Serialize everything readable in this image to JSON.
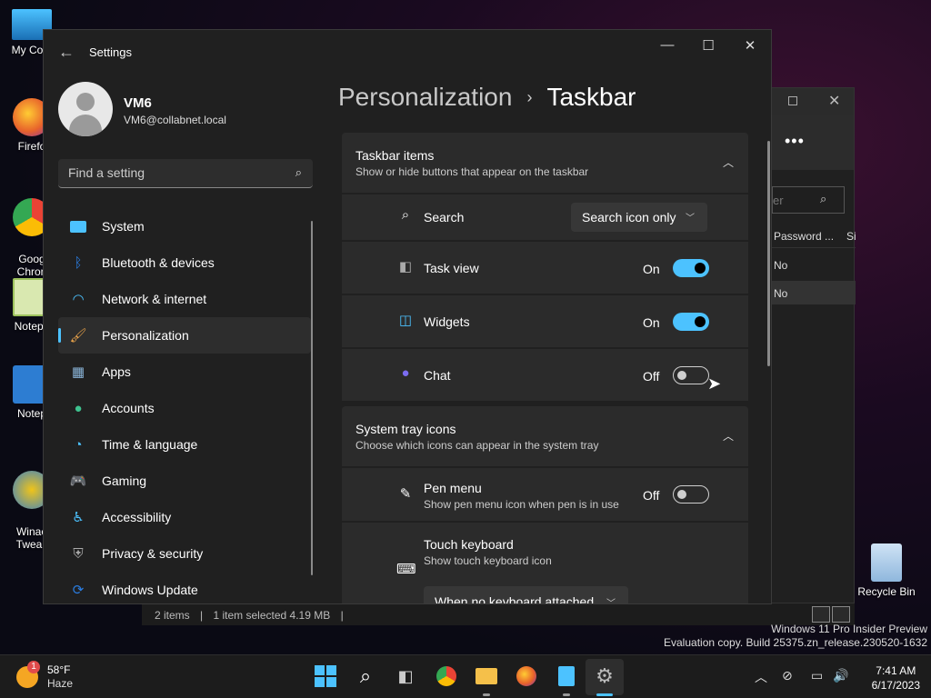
{
  "desktop": {
    "icons": [
      {
        "label": "My Com",
        "icon": "computer-icon",
        "color": "#2aa7e0"
      },
      {
        "label": "Firefo",
        "icon": "firefox-icon",
        "color": "#e8632b"
      },
      {
        "label": "Goog\nChron",
        "icon": "chrome-icon",
        "color": "#34a853"
      },
      {
        "label": "Notepa",
        "icon": "notepad-plus-icon",
        "color": "#9cc25c"
      },
      {
        "label": "Notep",
        "icon": "notepad-icon",
        "color": "#2d7dd2"
      },
      {
        "label": "Winae\nTweak",
        "icon": "winaero-tweaker-icon",
        "color": "#f0c419"
      },
      {
        "label": "Recycle Bin",
        "icon": "recycle-bin-icon",
        "color": "#9ec9f0"
      }
    ]
  },
  "explorer_bg": {
    "search_placeholder": "er",
    "col_password": "Password ...",
    "col_size": "Si",
    "rows": [
      "No",
      "No"
    ],
    "status": {
      "items": "2 items",
      "selected": "1 item selected  4.19 MB",
      "sep": "|"
    }
  },
  "watermark": {
    "line1": "Windows 11 Pro Insider Preview",
    "line2": "Evaluation copy. Build 25375.zn_release.230520-1632"
  },
  "settings": {
    "app_title": "Settings",
    "user": {
      "name": "VM6",
      "email": "VM6@collabnet.local"
    },
    "search_placeholder": "Find a setting",
    "nav": [
      {
        "label": "System",
        "icon": "monitor-icon",
        "color": "#4cc2ff"
      },
      {
        "label": "Bluetooth & devices",
        "icon": "bluetooth-icon",
        "color": "#2a7de1"
      },
      {
        "label": "Network & internet",
        "icon": "wifi-icon",
        "color": "#4cc2ff"
      },
      {
        "label": "Personalization",
        "icon": "paintbrush-icon",
        "color": "#e8a24a",
        "active": true
      },
      {
        "label": "Apps",
        "icon": "apps-icon",
        "color": "#8ab4d8"
      },
      {
        "label": "Accounts",
        "icon": "person-icon",
        "color": "#3ec28f"
      },
      {
        "label": "Time & language",
        "icon": "clock-globe-icon",
        "color": "#4cc2ff"
      },
      {
        "label": "Gaming",
        "icon": "gamepad-icon",
        "color": "#bbbbbb"
      },
      {
        "label": "Accessibility",
        "icon": "accessibility-icon",
        "color": "#4cc2ff"
      },
      {
        "label": "Privacy & security",
        "icon": "shield-icon",
        "color": "#aaaaaa"
      },
      {
        "label": "Windows Update",
        "icon": "update-icon",
        "color": "#2a7de1"
      }
    ],
    "breadcrumb": {
      "parent": "Personalization",
      "separator": "›",
      "current": "Taskbar"
    },
    "taskbar_items": {
      "title": "Taskbar items",
      "subtitle": "Show or hide buttons that appear on the taskbar",
      "rows": {
        "search": {
          "label": "Search",
          "value": "Search icon only"
        },
        "task_view": {
          "label": "Task view",
          "state": "On"
        },
        "widgets": {
          "label": "Widgets",
          "state": "On"
        },
        "chat": {
          "label": "Chat",
          "state": "Off"
        }
      }
    },
    "system_tray": {
      "title": "System tray icons",
      "subtitle": "Choose which icons can appear in the system tray",
      "pen": {
        "label": "Pen menu",
        "sub": "Show pen menu icon when pen is in use",
        "state": "Off"
      },
      "touch": {
        "label": "Touch keyboard",
        "sub": "Show touch keyboard icon",
        "value": "When no keyboard attached"
      }
    }
  },
  "taskbar": {
    "weather": {
      "temp": "58°F",
      "condition": "Haze",
      "badge": "1"
    },
    "time": "7:41 AM",
    "date": "6/17/2023"
  },
  "colors": {
    "accent": "#4cc2ff",
    "window_bg": "#202020",
    "card_bg": "#2b2b2b"
  }
}
